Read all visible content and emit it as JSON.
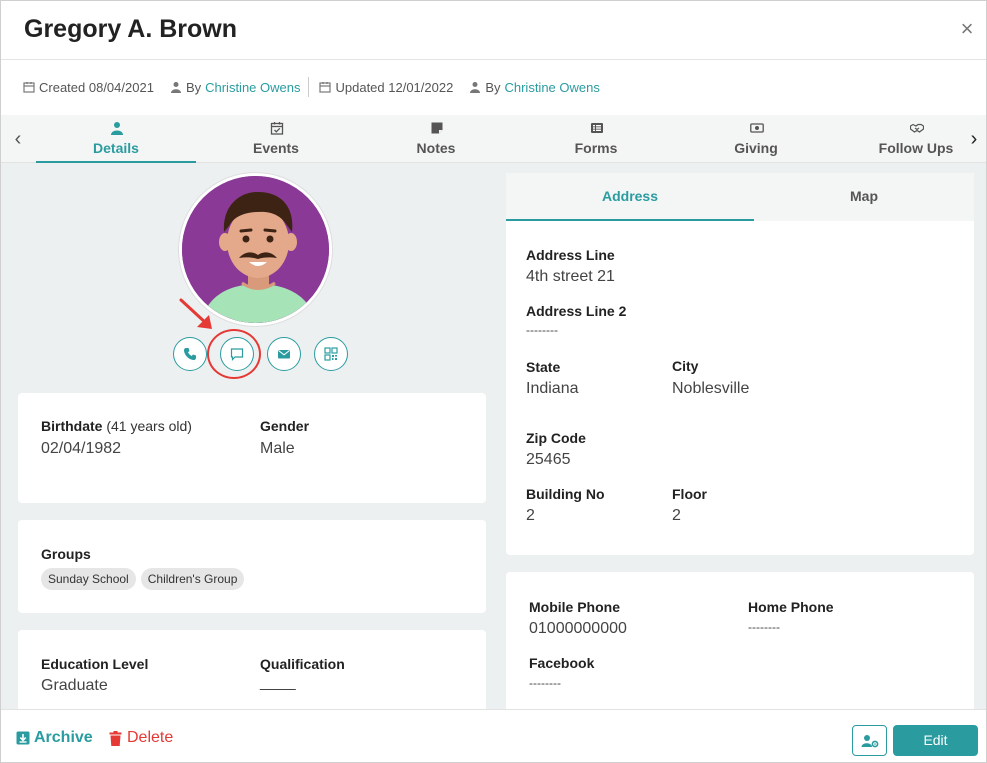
{
  "header": {
    "title": "Gregory A. Brown",
    "close_icon": "×"
  },
  "meta": {
    "created_label": "Created 08/04/2021",
    "by_label_1": "By",
    "created_by": "Christine Owens",
    "updated_label": "Updated 12/01/2022",
    "by_label_2": "By",
    "updated_by": "Christine Owens"
  },
  "tabs": {
    "left_arrow": "‹",
    "right_arrow": "›",
    "items": [
      {
        "label": "Details",
        "icon": "user-icon"
      },
      {
        "label": "Events",
        "icon": "calendar-check-icon"
      },
      {
        "label": "Notes",
        "icon": "note-icon"
      },
      {
        "label": "Forms",
        "icon": "list-icon"
      },
      {
        "label": "Giving",
        "icon": "money-icon"
      },
      {
        "label": "Follow Ups",
        "icon": "handshake-icon"
      }
    ]
  },
  "details": {
    "birthdate_label": "Birthdate",
    "birthdate_age": "(41 years old)",
    "birthdate_value": "02/04/1982",
    "gender_label": "Gender",
    "gender_value": "Male",
    "groups_label": "Groups",
    "groups": [
      "Sunday School",
      "Children's Group"
    ],
    "education_label": "Education Level",
    "education_value": "Graduate",
    "qualification_label": "Qualification",
    "qualification_value": "____"
  },
  "address_tabs": {
    "address": "Address",
    "map": "Map"
  },
  "address": {
    "line1_label": "Address Line",
    "line1_value": "4th street 21",
    "line2_label": "Address Line 2",
    "line2_value": "--------",
    "state_label": "State",
    "state_value": "Indiana",
    "city_label": "City",
    "city_value": "Noblesville",
    "zip_label": "Zip Code",
    "zip_value": "25465",
    "building_label": "Building No",
    "building_value": "2",
    "floor_label": "Floor",
    "floor_value": "2"
  },
  "contact": {
    "mobile_label": "Mobile Phone",
    "mobile_value": "01000000000",
    "home_label": "Home Phone",
    "home_value": "--------",
    "facebook_label": "Facebook",
    "facebook_value": "--------"
  },
  "footer": {
    "archive_label": "Archive",
    "delete_label": "Delete",
    "edit_label": "Edit"
  },
  "colors": {
    "accent": "#2a9ca0",
    "danger": "#e53935",
    "avatar_bg": "#8a3a96"
  }
}
